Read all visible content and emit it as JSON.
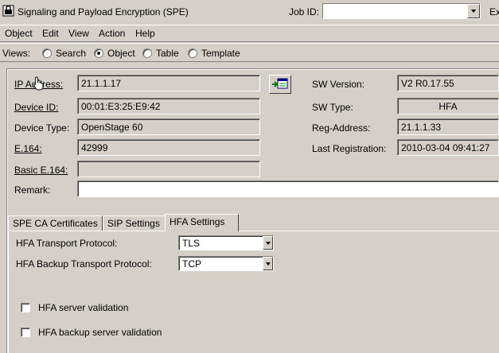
{
  "window": {
    "title": "Signaling and Payload Encryption (SPE)",
    "job_id_label": "Job ID:",
    "job_id_value": "",
    "ex_label": "Ex"
  },
  "menu": [
    "Object",
    "Edit",
    "View",
    "Action",
    "Help"
  ],
  "views": {
    "label": "Views:",
    "options": [
      "Search",
      "Object",
      "Table",
      "Template"
    ],
    "selected": "Object"
  },
  "device": {
    "ip_address_label": "IP Address:",
    "ip_address": "21.1.1.17",
    "device_id_label": "Device ID:",
    "device_id": "00:01:E3:25:E9:42",
    "device_type_label": "Device Type:",
    "device_type": "OpenStage 60",
    "e164_label": "E.164:",
    "e164": "42999",
    "basic_e164_label": "Basic E.164:",
    "basic_e164": "",
    "remark_label": "Remark:",
    "remark": "",
    "sw_version_label": "SW Version:",
    "sw_version": "V2 R0.17.55",
    "sw_type_label": "SW Type:",
    "sw_type": "HFA",
    "reg_address_label": "Reg-Address:",
    "reg_address": "21.1.1.33",
    "last_registration_label": "Last Registration:",
    "last_registration": "2010-03-04 09:41:27"
  },
  "tabs": [
    "SPE CA Certificates",
    "SIP Settings",
    "HFA Settings"
  ],
  "active_tab": "HFA Settings",
  "hfa": {
    "transport_label": "HFA Transport Protocol:",
    "transport_value": "TLS",
    "backup_transport_label": "HFA Backup Transport Protocol:",
    "backup_transport_value": "TCP",
    "server_validation_label": "HFA server validation",
    "backup_server_validation_label": "HFA backup server validation"
  }
}
